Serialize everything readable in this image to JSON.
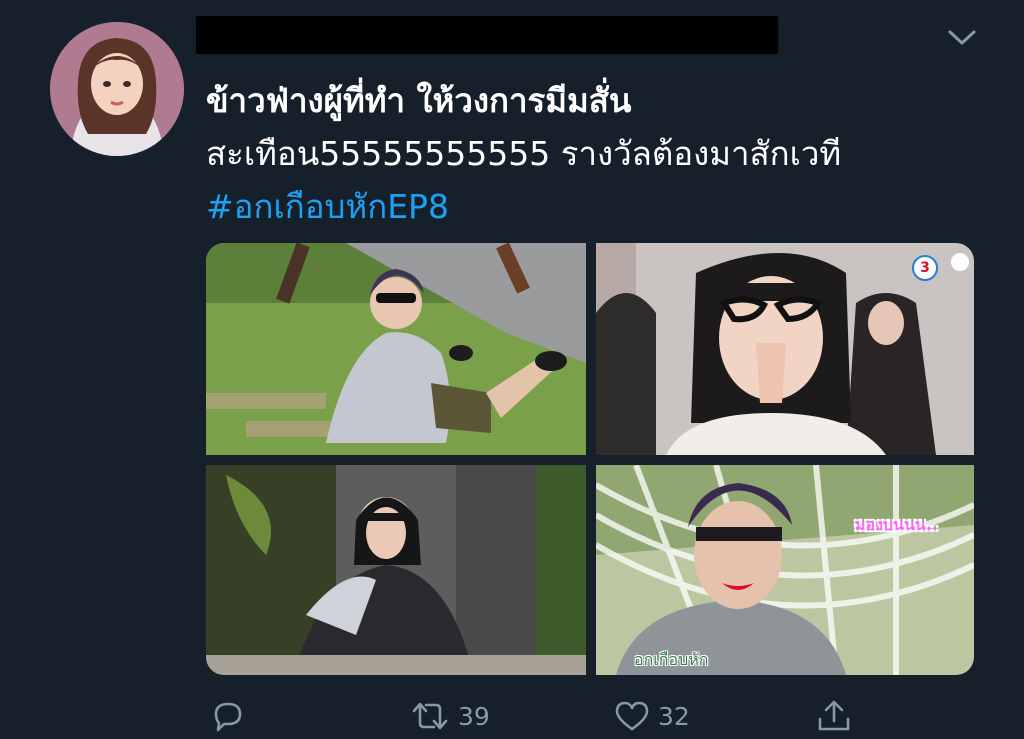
{
  "tweet": {
    "author_name": "",
    "text_line1": "ข้าวฟ่างผู้ที่ทำ ให้วงการมีมสั่น",
    "text_line2": "สะเทือน55555555555 รางวัลต้องมาสักเวที",
    "hashtag": "#อกเกือบหักEP8"
  },
  "media": {
    "photo4_caption_top": "มองบนนน..",
    "photo4_caption_bottom": "อกเกือบหัก",
    "channel_logo": "3"
  },
  "actions": {
    "reply_count": "",
    "retweet_count": "39",
    "like_count": "32"
  },
  "colors": {
    "background": "#15202b",
    "text": "#ffffff",
    "link": "#1da1f2",
    "icon": "#8899a6"
  },
  "icons": [
    "chevron-down-icon",
    "reply-icon",
    "retweet-icon",
    "like-icon",
    "share-icon"
  ]
}
